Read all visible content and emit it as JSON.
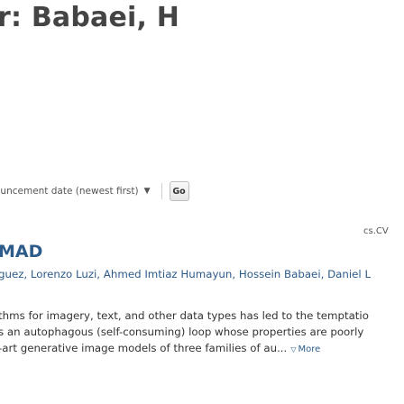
{
  "header": {
    "title": "r: Babaei, H"
  },
  "sort": {
    "selected": "ouncement date (newest first)",
    "go_label": "Go",
    "dropdown_icon": "chevron-down-icon"
  },
  "result": {
    "category": "cs.CV",
    "title": "MAD",
    "authors": "guez, Lorenzo Luzi, Ahmed Imtiaz Humayun, Hossein Babaei, Daniel L",
    "abstract_lines": [
      "thms for imagery, text, and other data types has led to the temptatio",
      "s an autophagous (self-consuming) loop whose properties are poorly",
      "-art generative image models of three families of au..."
    ],
    "more_label": "More",
    "more_icon": "triangle-down-icon"
  }
}
